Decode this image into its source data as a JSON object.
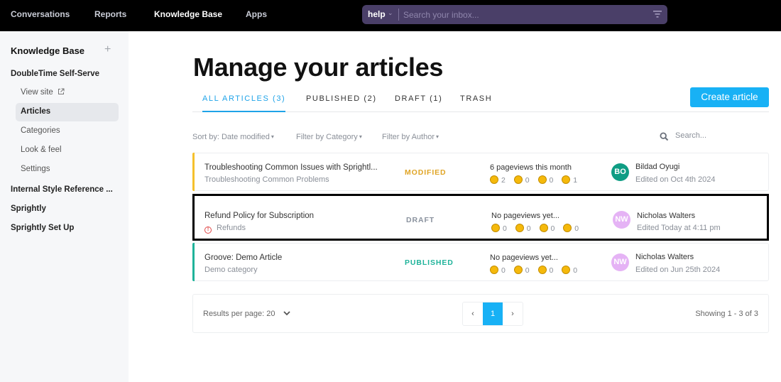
{
  "topnav": {
    "items": [
      {
        "label": "Conversations",
        "active": false
      },
      {
        "label": "Reports",
        "active": false
      },
      {
        "label": "Knowledge Base",
        "active": true
      },
      {
        "label": "Apps",
        "active": false
      }
    ],
    "search": {
      "scope": "help",
      "placeholder": "Search your inbox...",
      "value": ""
    }
  },
  "sidebar": {
    "title": "Knowledge Base",
    "add_icon": "plus-icon",
    "sites": [
      {
        "label": "DoubleTime Self-Serve"
      },
      {
        "label": "Internal Style Reference ..."
      },
      {
        "label": "Sprightly"
      },
      {
        "label": "Sprightly Set Up"
      }
    ],
    "subitems": [
      {
        "label": "View site",
        "icon": "external-link-icon"
      },
      {
        "label": "Articles",
        "active": true
      },
      {
        "label": "Categories"
      },
      {
        "label": "Look & feel"
      },
      {
        "label": "Settings"
      }
    ]
  },
  "main": {
    "title": "Manage your articles",
    "tabs": [
      {
        "label": "ALL ARTICLES (3)",
        "active": true
      },
      {
        "label": "PUBLISHED (2)"
      },
      {
        "label": "DRAFT (1)"
      },
      {
        "label": "TRASH"
      }
    ],
    "create_label": "Create article",
    "filters": {
      "sort": "Sort by: Date modified",
      "category": "Filter by Category",
      "author": "Filter by Author",
      "search_placeholder": "Search..."
    },
    "articles": [
      {
        "title": "Troubleshooting Common Issues with Sprightl...",
        "category": "Troubleshooting Common Problems",
        "status": "MODIFIED",
        "status_color": "#e0a526",
        "bar_color": "#f5c02c",
        "views": "6 pageviews this month",
        "reactions": [
          "2",
          "0",
          "0",
          "1"
        ],
        "author_initials": "BO",
        "author_color": "#0f9d84",
        "author": "Bildad Oyugi",
        "edited": "Edited on Oct 4th 2024"
      },
      {
        "title": "Refund Policy for Subscription",
        "category": "Refunds",
        "category_warning": true,
        "status": "DRAFT",
        "status_color": "#8a929e",
        "views": "No pageviews yet...",
        "reactions": [
          "0",
          "0",
          "0",
          "0"
        ],
        "author_initials": "NW",
        "author_color": "#e5b3f5",
        "author": "Nicholas Walters",
        "edited": "Edited Today at 4:11 pm",
        "selected": true
      },
      {
        "title": "Groove: Demo Article",
        "category": "Demo category",
        "status": "PUBLISHED",
        "status_color": "#1fb39a",
        "bar_color": "#1fb39a",
        "views": "No pageviews yet...",
        "reactions": [
          "0",
          "0",
          "0",
          "0"
        ],
        "author_initials": "NW",
        "author_color": "#e5b3f5",
        "author": "Nicholas Walters",
        "edited": "Edited on Jun 25th 2024"
      }
    ],
    "pagination": {
      "results_per_page": "Results per page: 20",
      "prev": "‹",
      "current": "1",
      "next": "›",
      "showing": "Showing 1 - 3 of 3"
    }
  }
}
